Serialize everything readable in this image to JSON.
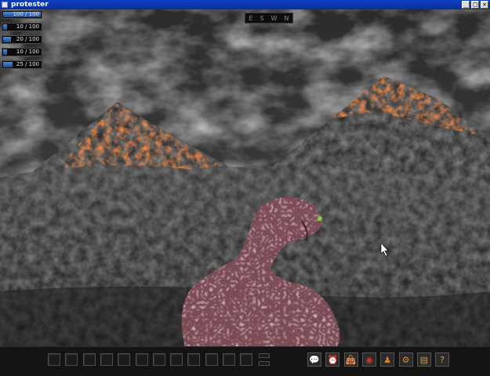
{
  "window": {
    "title": "protester"
  },
  "window_controls": {
    "minimize": "_",
    "maximize": "□",
    "close": "✕"
  },
  "stats": [
    {
      "label": "100 / 100",
      "value": 100,
      "max": 100
    },
    {
      "label": "10 / 100",
      "value": 10,
      "max": 100
    },
    {
      "label": "20 / 100",
      "value": 20,
      "max": 100
    },
    {
      "label": "10 / 100",
      "value": 10,
      "max": 100
    },
    {
      "label": "25 / 100",
      "value": 25,
      "max": 100
    }
  ],
  "compass": [
    "E",
    "S",
    "W",
    "N"
  ],
  "hotbar": {
    "slot_count": 12
  },
  "menu_icons": [
    {
      "name": "chat-icon",
      "glyph": "💬",
      "color": "#d9a22a"
    },
    {
      "name": "clock-icon",
      "glyph": "⏰",
      "color": "#c87a1e"
    },
    {
      "name": "bag-icon",
      "glyph": "👜",
      "color": "#c24a14"
    },
    {
      "name": "color-wheel-icon",
      "glyph": "◉",
      "color": "#cc3a2a"
    },
    {
      "name": "character-icon",
      "glyph": "♟",
      "color": "#d9822a"
    },
    {
      "name": "settings-icon",
      "glyph": "⚙",
      "color": "#d98a2a"
    },
    {
      "name": "map-icon",
      "glyph": "▤",
      "color": "#c89a5a"
    },
    {
      "name": "help-icon",
      "glyph": "?",
      "color": "#d9a22a"
    }
  ]
}
